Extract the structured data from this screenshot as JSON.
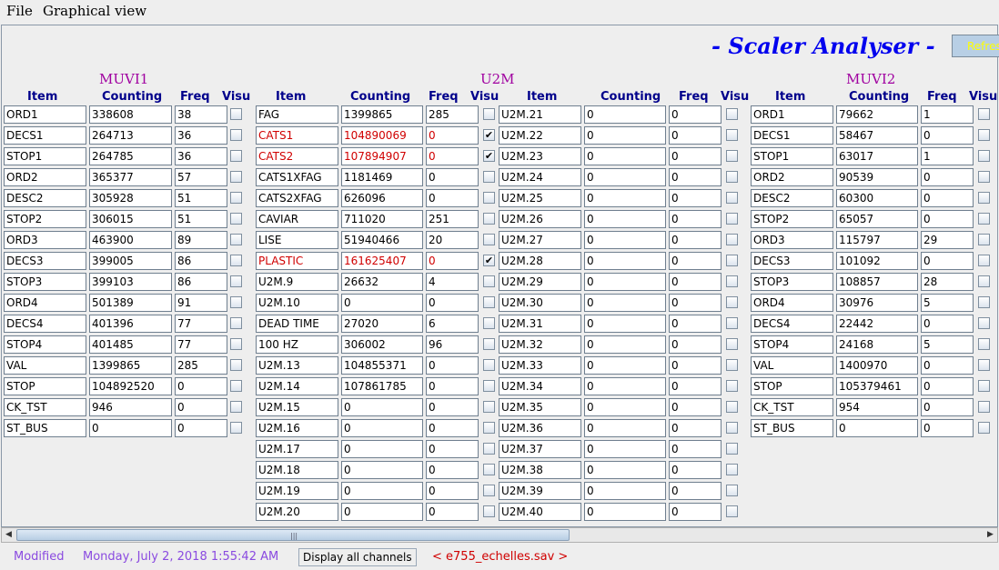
{
  "menubar": {
    "file": "File",
    "graphical_view": "Graphical view"
  },
  "header": {
    "title": "- Scaler Analyser -",
    "refresh_button": "Refresh"
  },
  "columns": {
    "item": "Item",
    "counting": "Counting",
    "freq": "Freq",
    "visu": "Visu"
  },
  "groups": [
    {
      "name": "MUVI1",
      "rows": [
        {
          "item": "ORD1",
          "counting": "338608",
          "freq": "38",
          "visu": false,
          "alert": false
        },
        {
          "item": "DECS1",
          "counting": "264713",
          "freq": "36",
          "visu": false,
          "alert": false
        },
        {
          "item": "STOP1",
          "counting": "264785",
          "freq": "36",
          "visu": false,
          "alert": false
        },
        {
          "item": "ORD2",
          "counting": "365377",
          "freq": "57",
          "visu": false,
          "alert": false
        },
        {
          "item": "DESC2",
          "counting": "305928",
          "freq": "51",
          "visu": false,
          "alert": false
        },
        {
          "item": "STOP2",
          "counting": "306015",
          "freq": "51",
          "visu": false,
          "alert": false
        },
        {
          "item": "ORD3",
          "counting": "463900",
          "freq": "89",
          "visu": false,
          "alert": false
        },
        {
          "item": "DECS3",
          "counting": "399005",
          "freq": "86",
          "visu": false,
          "alert": false
        },
        {
          "item": "STOP3",
          "counting": "399103",
          "freq": "86",
          "visu": false,
          "alert": false
        },
        {
          "item": "ORD4",
          "counting": "501389",
          "freq": "91",
          "visu": false,
          "alert": false
        },
        {
          "item": "DECS4",
          "counting": "401396",
          "freq": "77",
          "visu": false,
          "alert": false
        },
        {
          "item": "STOP4",
          "counting": "401485",
          "freq": "77",
          "visu": false,
          "alert": false
        },
        {
          "item": "VAL",
          "counting": "1399865",
          "freq": "285",
          "visu": false,
          "alert": false
        },
        {
          "item": "STOP",
          "counting": "104892520",
          "freq": "0",
          "visu": false,
          "alert": false
        },
        {
          "item": "CK_TST",
          "counting": "946",
          "freq": "0",
          "visu": false,
          "alert": false
        },
        {
          "item": "ST_BUS",
          "counting": "0",
          "freq": "0",
          "visu": false,
          "alert": false
        }
      ]
    },
    {
      "name": "U2M",
      "rows": [
        {
          "item": "FAG",
          "counting": "1399865",
          "freq": "285",
          "visu": false,
          "alert": false
        },
        {
          "item": "CATS1",
          "counting": "104890069",
          "freq": "0",
          "visu": true,
          "alert": true
        },
        {
          "item": "CATS2",
          "counting": "107894907",
          "freq": "0",
          "visu": true,
          "alert": true
        },
        {
          "item": "CATS1XFAG",
          "counting": "1181469",
          "freq": "0",
          "visu": false,
          "alert": false
        },
        {
          "item": "CATS2XFAG",
          "counting": "626096",
          "freq": "0",
          "visu": false,
          "alert": false
        },
        {
          "item": "CAVIAR",
          "counting": "711020",
          "freq": "251",
          "visu": false,
          "alert": false
        },
        {
          "item": "LISE",
          "counting": "51940466",
          "freq": "20",
          "visu": false,
          "alert": false
        },
        {
          "item": "PLASTIC",
          "counting": "161625407",
          "freq": "0",
          "visu": true,
          "alert": true
        },
        {
          "item": "U2M.9",
          "counting": "26632",
          "freq": "4",
          "visu": false,
          "alert": false
        },
        {
          "item": "U2M.10",
          "counting": "0",
          "freq": "0",
          "visu": false,
          "alert": false
        },
        {
          "item": "DEAD TIME",
          "counting": "27020",
          "freq": "6",
          "visu": false,
          "alert": false
        },
        {
          "item": "100 HZ",
          "counting": "306002",
          "freq": "96",
          "visu": false,
          "alert": false
        },
        {
          "item": "U2M.13",
          "counting": "104855371",
          "freq": "0",
          "visu": false,
          "alert": false
        },
        {
          "item": "U2M.14",
          "counting": "107861785",
          "freq": "0",
          "visu": false,
          "alert": false
        },
        {
          "item": "U2M.15",
          "counting": "0",
          "freq": "0",
          "visu": false,
          "alert": false
        },
        {
          "item": "U2M.16",
          "counting": "0",
          "freq": "0",
          "visu": false,
          "alert": false
        },
        {
          "item": "U2M.17",
          "counting": "0",
          "freq": "0",
          "visu": false,
          "alert": false
        },
        {
          "item": "U2M.18",
          "counting": "0",
          "freq": "0",
          "visu": false,
          "alert": false
        },
        {
          "item": "U2M.19",
          "counting": "0",
          "freq": "0",
          "visu": false,
          "alert": false
        },
        {
          "item": "U2M.20",
          "counting": "0",
          "freq": "0",
          "visu": false,
          "alert": false
        }
      ]
    },
    {
      "name": "",
      "rows": [
        {
          "item": "U2M.21",
          "counting": "0",
          "freq": "0",
          "visu": false,
          "alert": false
        },
        {
          "item": "U2M.22",
          "counting": "0",
          "freq": "0",
          "visu": false,
          "alert": false
        },
        {
          "item": "U2M.23",
          "counting": "0",
          "freq": "0",
          "visu": false,
          "alert": false
        },
        {
          "item": "U2M.24",
          "counting": "0",
          "freq": "0",
          "visu": false,
          "alert": false
        },
        {
          "item": "U2M.25",
          "counting": "0",
          "freq": "0",
          "visu": false,
          "alert": false
        },
        {
          "item": "U2M.26",
          "counting": "0",
          "freq": "0",
          "visu": false,
          "alert": false
        },
        {
          "item": "U2M.27",
          "counting": "0",
          "freq": "0",
          "visu": false,
          "alert": false
        },
        {
          "item": "U2M.28",
          "counting": "0",
          "freq": "0",
          "visu": false,
          "alert": false
        },
        {
          "item": "U2M.29",
          "counting": "0",
          "freq": "0",
          "visu": false,
          "alert": false
        },
        {
          "item": "U2M.30",
          "counting": "0",
          "freq": "0",
          "visu": false,
          "alert": false
        },
        {
          "item": "U2M.31",
          "counting": "0",
          "freq": "0",
          "visu": false,
          "alert": false
        },
        {
          "item": "U2M.32",
          "counting": "0",
          "freq": "0",
          "visu": false,
          "alert": false
        },
        {
          "item": "U2M.33",
          "counting": "0",
          "freq": "0",
          "visu": false,
          "alert": false
        },
        {
          "item": "U2M.34",
          "counting": "0",
          "freq": "0",
          "visu": false,
          "alert": false
        },
        {
          "item": "U2M.35",
          "counting": "0",
          "freq": "0",
          "visu": false,
          "alert": false
        },
        {
          "item": "U2M.36",
          "counting": "0",
          "freq": "0",
          "visu": false,
          "alert": false
        },
        {
          "item": "U2M.37",
          "counting": "0",
          "freq": "0",
          "visu": false,
          "alert": false
        },
        {
          "item": "U2M.38",
          "counting": "0",
          "freq": "0",
          "visu": false,
          "alert": false
        },
        {
          "item": "U2M.39",
          "counting": "0",
          "freq": "0",
          "visu": false,
          "alert": false
        },
        {
          "item": "U2M.40",
          "counting": "0",
          "freq": "0",
          "visu": false,
          "alert": false
        }
      ]
    },
    {
      "name": "MUVI2",
      "rows": [
        {
          "item": "ORD1",
          "counting": "79662",
          "freq": "1",
          "visu": false,
          "alert": false
        },
        {
          "item": "DECS1",
          "counting": "58467",
          "freq": "0",
          "visu": false,
          "alert": false
        },
        {
          "item": "STOP1",
          "counting": "63017",
          "freq": "1",
          "visu": false,
          "alert": false
        },
        {
          "item": "ORD2",
          "counting": "90539",
          "freq": "0",
          "visu": false,
          "alert": false
        },
        {
          "item": "DESC2",
          "counting": "60300",
          "freq": "0",
          "visu": false,
          "alert": false
        },
        {
          "item": "STOP2",
          "counting": "65057",
          "freq": "0",
          "visu": false,
          "alert": false
        },
        {
          "item": "ORD3",
          "counting": "115797",
          "freq": "29",
          "visu": false,
          "alert": false
        },
        {
          "item": "DECS3",
          "counting": "101092",
          "freq": "0",
          "visu": false,
          "alert": false
        },
        {
          "item": "STOP3",
          "counting": "108857",
          "freq": "28",
          "visu": false,
          "alert": false
        },
        {
          "item": "ORD4",
          "counting": "30976",
          "freq": "5",
          "visu": false,
          "alert": false
        },
        {
          "item": "DECS4",
          "counting": "22442",
          "freq": "0",
          "visu": false,
          "alert": false
        },
        {
          "item": "STOP4",
          "counting": "24168",
          "freq": "5",
          "visu": false,
          "alert": false
        },
        {
          "item": "VAL",
          "counting": "1400970",
          "freq": "0",
          "visu": false,
          "alert": false
        },
        {
          "item": "STOP",
          "counting": "105379461",
          "freq": "0",
          "visu": false,
          "alert": false
        },
        {
          "item": "CK_TST",
          "counting": "954",
          "freq": "0",
          "visu": false,
          "alert": false
        },
        {
          "item": "ST_BUS",
          "counting": "0",
          "freq": "0",
          "visu": false,
          "alert": false
        }
      ]
    }
  ],
  "statusbar": {
    "modified": "Modified",
    "datetime": "Monday, July 2, 2018 1:55:42 AM",
    "display_all_button": "Display all channels",
    "filename": "< e755_echelles.sav >"
  },
  "colors": {
    "title": "#0000ee",
    "section": "#a000a0",
    "header": "#00008b",
    "alert": "#d00000",
    "status": "#8a4ae0"
  }
}
